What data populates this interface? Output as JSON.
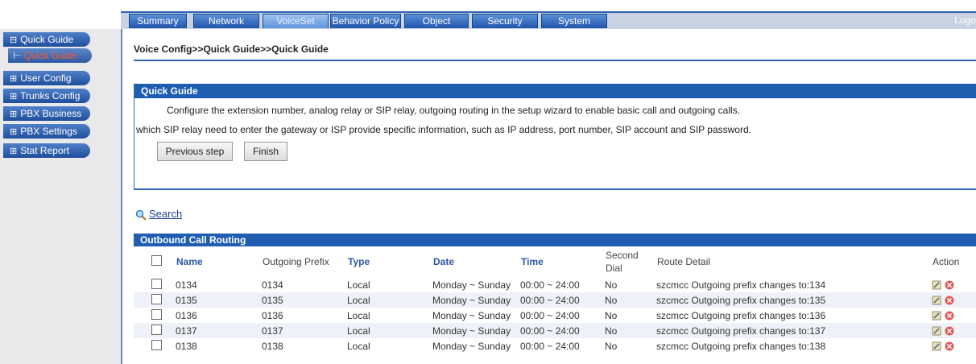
{
  "nav": {
    "tabs": [
      "Summary",
      "Network",
      "VoiceSet",
      "Behavior Policy",
      "Object",
      "Security",
      "System"
    ],
    "active": "VoiceSet",
    "logout": "Logo"
  },
  "sidebar": {
    "items": [
      {
        "label": "Quick Guide",
        "icon": "minus-box-icon"
      },
      {
        "label": "User Config",
        "icon": "plus-box-icon"
      },
      {
        "label": "Trunks Config",
        "icon": "plus-box-icon"
      },
      {
        "label": "PBX Business",
        "icon": "plus-box-icon"
      },
      {
        "label": "PBX Settings",
        "icon": "plus-box-icon"
      },
      {
        "label": "Stat Report",
        "icon": "plus-box-icon"
      }
    ],
    "sub_item": "Quick Guide"
  },
  "breadcrumb": "Voice Config>>Quick Guide>>Quick Guide",
  "quick_guide": {
    "title": "Quick Guide",
    "line1": "Configure the extension number, analog relay or SIP relay, outgoing routing in the setup wizard to enable basic call and outgoing calls.",
    "line2": "which SIP relay need to enter the gateway or ISP provide specific information, such as IP address, port number, SIP account and SIP password.",
    "prev_button": "Previous step",
    "finish_button": "Finish"
  },
  "search": {
    "label": "Search"
  },
  "routing": {
    "title": "Outbound Call Routing",
    "columns": {
      "name": "Name",
      "prefix": "Outgoing Prefix",
      "type": "Type",
      "date": "Date",
      "time": "Time",
      "second_dial_1": "Second",
      "second_dial_2": "Dial",
      "route_detail": "Route Detail",
      "action": "Action"
    },
    "rows": [
      {
        "name": "0134",
        "prefix": "0134",
        "type": "Local",
        "date": "Monday ~ Sunday",
        "time": "00:00 ~ 24:00",
        "second_dial": "No",
        "detail": "szcmcc Outgoing prefix changes to:134"
      },
      {
        "name": "0135",
        "prefix": "0135",
        "type": "Local",
        "date": "Monday ~ Sunday",
        "time": "00:00 ~ 24:00",
        "second_dial": "No",
        "detail": "szcmcc Outgoing prefix changes to:135"
      },
      {
        "name": "0136",
        "prefix": "0136",
        "type": "Local",
        "date": "Monday ~ Sunday",
        "time": "00:00 ~ 24:00",
        "second_dial": "No",
        "detail": "szcmcc Outgoing prefix changes to:136"
      },
      {
        "name": "0137",
        "prefix": "0137",
        "type": "Local",
        "date": "Monday ~ Sunday",
        "time": "00:00 ~ 24:00",
        "second_dial": "No",
        "detail": "szcmcc Outgoing prefix changes to:137"
      },
      {
        "name": "0138",
        "prefix": "0138",
        "type": "Local",
        "date": "Monday ~ Sunday",
        "time": "00:00 ~ 24:00",
        "second_dial": "No",
        "detail": "szcmcc Outgoing prefix changes to:138"
      }
    ]
  }
}
